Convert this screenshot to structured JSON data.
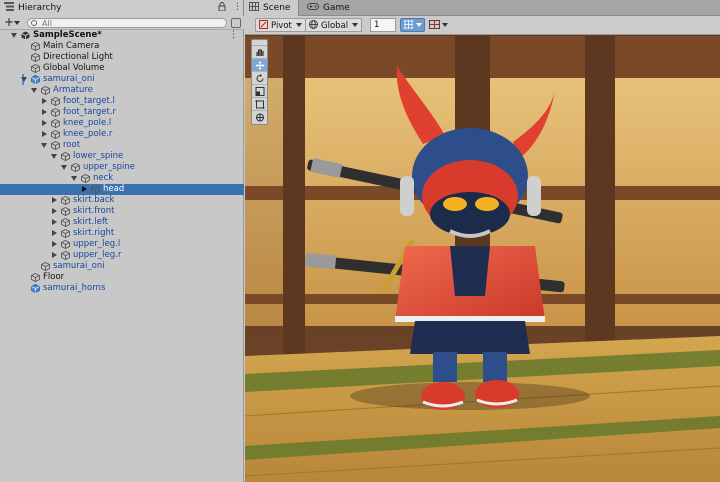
{
  "hierarchy": {
    "tab_title": "Hierarchy",
    "add_label": "+",
    "search_placeholder": "All",
    "more_label": "⋮",
    "lock_label": "🔒",
    "rows": [
      {
        "label": "SampleScene*",
        "depth": 0,
        "expander": "down",
        "icon": "unity-scene-icon",
        "style": "bold",
        "more": true
      },
      {
        "label": "Main Camera",
        "depth": 1,
        "expander": "none",
        "icon": "gameobject-cube-icon",
        "style": "normal"
      },
      {
        "label": "Directional Light",
        "depth": 1,
        "expander": "none",
        "icon": "gameobject-cube-icon",
        "style": "normal"
      },
      {
        "label": "Global Volume",
        "depth": 1,
        "expander": "none",
        "icon": "gameobject-cube-icon",
        "style": "normal"
      },
      {
        "label": "samurai_oni",
        "depth": 1,
        "expander": "down",
        "icon": "prefab-cube-icon",
        "style": "prefab",
        "marker": true
      },
      {
        "label": "Armature",
        "depth": 2,
        "expander": "down",
        "icon": "gameobject-cube-icon",
        "style": "prefab"
      },
      {
        "label": "foot_target.l",
        "depth": 3,
        "expander": "right",
        "icon": "gameobject-cube-icon",
        "style": "prefab"
      },
      {
        "label": "foot_target.r",
        "depth": 3,
        "expander": "right",
        "icon": "gameobject-cube-icon",
        "style": "prefab"
      },
      {
        "label": "knee_pole.l",
        "depth": 3,
        "expander": "right",
        "icon": "gameobject-cube-icon",
        "style": "prefab"
      },
      {
        "label": "knee_pole.r",
        "depth": 3,
        "expander": "right",
        "icon": "gameobject-cube-icon",
        "style": "prefab"
      },
      {
        "label": "root",
        "depth": 3,
        "expander": "down",
        "icon": "gameobject-cube-icon",
        "style": "prefab"
      },
      {
        "label": "lower_spine",
        "depth": 4,
        "expander": "down",
        "icon": "gameobject-cube-icon",
        "style": "prefab"
      },
      {
        "label": "upper_spine",
        "depth": 5,
        "expander": "down",
        "icon": "gameobject-cube-icon",
        "style": "prefab"
      },
      {
        "label": "neck",
        "depth": 6,
        "expander": "down",
        "icon": "gameobject-cube-icon",
        "style": "prefab"
      },
      {
        "label": "head",
        "depth": 7,
        "expander": "right",
        "icon": "gameobject-cube-icon",
        "style": "prefab",
        "selected": true
      },
      {
        "label": "skirt.back",
        "depth": 4,
        "expander": "right",
        "icon": "gameobject-cube-icon",
        "style": "prefab"
      },
      {
        "label": "skirt.front",
        "depth": 4,
        "expander": "right",
        "icon": "gameobject-cube-icon",
        "style": "prefab"
      },
      {
        "label": "skirt.left",
        "depth": 4,
        "expander": "right",
        "icon": "gameobject-cube-icon",
        "style": "prefab"
      },
      {
        "label": "skirt.right",
        "depth": 4,
        "expander": "right",
        "icon": "gameobject-cube-icon",
        "style": "prefab"
      },
      {
        "label": "upper_leg.l",
        "depth": 4,
        "expander": "right",
        "icon": "gameobject-cube-icon",
        "style": "prefab"
      },
      {
        "label": "upper_leg.r",
        "depth": 4,
        "expander": "right",
        "icon": "gameobject-cube-icon",
        "style": "prefab"
      },
      {
        "label": "samurai_oni",
        "depth": 2,
        "expander": "none",
        "icon": "gameobject-cube-icon",
        "style": "prefab"
      },
      {
        "label": "Floor",
        "depth": 1,
        "expander": "none",
        "icon": "gameobject-cube-icon",
        "style": "normal"
      },
      {
        "label": "samurai_horns",
        "depth": 1,
        "expander": "none",
        "icon": "prefab-cube-icon",
        "style": "prefab"
      }
    ]
  },
  "scene": {
    "tabs": [
      {
        "label": "Scene",
        "icon": "scene-grid-icon",
        "active": true
      },
      {
        "label": "Game",
        "icon": "game-controller-icon",
        "active": false
      }
    ],
    "toolbar": {
      "pivot_label": "Pivot",
      "global_label": "Global",
      "snap_value": "1"
    },
    "tools": [
      {
        "name": "hand-tool",
        "icon": "hand-icon",
        "active": false
      },
      {
        "name": "move-tool",
        "icon": "move-arrows-icon",
        "active": true
      },
      {
        "name": "rotate-tool",
        "icon": "rotate-icon",
        "active": false
      },
      {
        "name": "scale-tool",
        "icon": "scale-icon",
        "active": false
      },
      {
        "name": "rect-tool",
        "icon": "rect-transform-icon",
        "active": false
      },
      {
        "name": "transform-tool",
        "icon": "transform-icon",
        "active": false
      }
    ]
  },
  "colors": {
    "selection": "#3a72b0",
    "prefab_text": "#16479e",
    "panel_bg": "#c8c8c8"
  }
}
